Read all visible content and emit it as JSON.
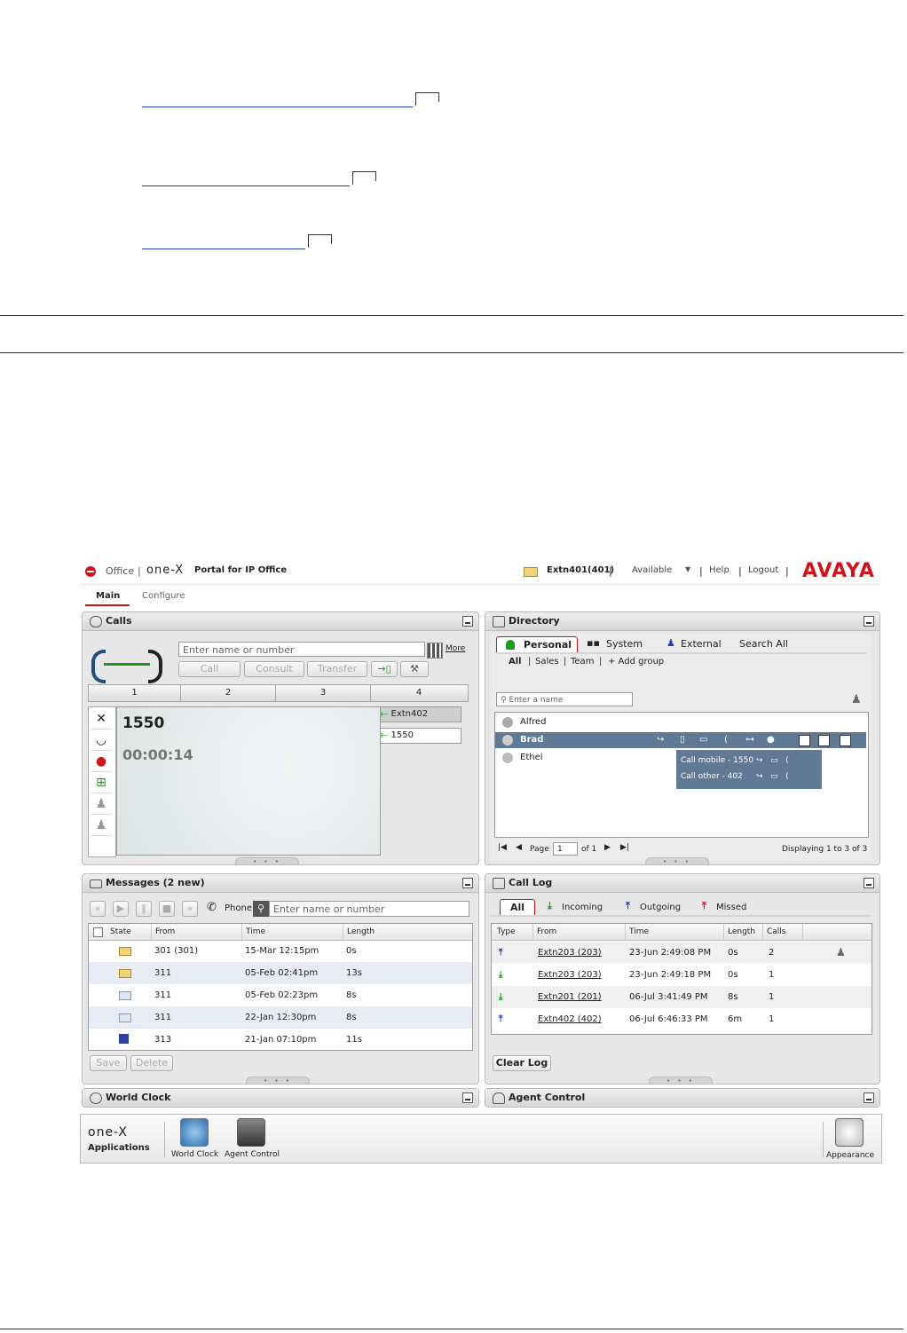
{
  "document": {
    "rule_label": ""
  },
  "app": {
    "title_office": "Office",
    "brand_product": "Portal for IP Office",
    "onex_logo": "one-X",
    "user": "Extn401(401)",
    "status": "Available",
    "help": "Help",
    "logout": "Logout",
    "vendor": "AVAYA",
    "tabs": [
      "Main",
      "Configure"
    ]
  },
  "calls": {
    "title": "Calls",
    "input_placeholder": "Enter name or number",
    "more": "More",
    "buttons": {
      "call": "Call",
      "consult": "Consult",
      "transfer": "Transfer"
    },
    "lines": [
      "1",
      "2",
      "3",
      "4"
    ],
    "active_number": "1550",
    "timer": "00:00:14",
    "right_lines": [
      "Extn402",
      "1550"
    ]
  },
  "directory": {
    "title": "Directory",
    "tabs": [
      "Personal",
      "System",
      "External",
      "Search All"
    ],
    "subtabs": [
      "All",
      "Sales",
      "Team",
      "+ Add group"
    ],
    "search_placeholder": "Enter a name",
    "entries": [
      "Alfred",
      "Brad",
      "Ethel"
    ],
    "popup": [
      "Call mobile - 1550",
      "Call other - 402"
    ],
    "page_label": "Page",
    "page_value": "1",
    "of_pages": "of 1",
    "displaying": "Displaying 1 to 3 of 3"
  },
  "messages": {
    "title": "Messages (2 new)",
    "phone_label": "Phone",
    "search_placeholder": "Enter name or number",
    "headers": [
      "State",
      "From",
      "Time",
      "Length"
    ],
    "rows": [
      {
        "from": "301 (301)",
        "time": "15-Mar 12:15pm",
        "length": "0s"
      },
      {
        "from": "311",
        "time": "05-Feb 02:41pm",
        "length": "13s"
      },
      {
        "from": "311",
        "time": "05-Feb 02:23pm",
        "length": "8s"
      },
      {
        "from": "311",
        "time": "22-Jan 12:30pm",
        "length": "8s"
      },
      {
        "from": "313",
        "time": "21-Jan 07:10pm",
        "length": "11s"
      }
    ],
    "save": "Save",
    "delete": "Delete"
  },
  "calllog": {
    "title": "Call Log",
    "tabs": [
      "All",
      "Incoming",
      "Outgoing",
      "Missed"
    ],
    "headers": [
      "Type",
      "From",
      "Time",
      "Length",
      "Calls"
    ],
    "rows": [
      {
        "dir": "out",
        "from": "Extn203 (203)",
        "time": "23-Jun 2:49:08 PM",
        "length": "0s",
        "calls": "2"
      },
      {
        "dir": "in",
        "from": "Extn203 (203)",
        "time": "23-Jun 2:49:18 PM",
        "length": "0s",
        "calls": "1"
      },
      {
        "dir": "in",
        "from": "Extn201 (201)",
        "time": "06-Jul 3:41:49 PM",
        "length": "8s",
        "calls": "1"
      },
      {
        "dir": "out",
        "from": "Extn402 (402)",
        "time": "06-Jul 6:46:33 PM",
        "length": "6m",
        "calls": "1"
      }
    ],
    "clear": "Clear Log"
  },
  "worldclock": {
    "title": "World Clock"
  },
  "agent": {
    "title": "Agent Control"
  },
  "apps": {
    "label": "Applications",
    "items": [
      "World Clock",
      "Agent Control"
    ],
    "appearance": "Appearance"
  },
  "colors": {
    "accent_red": "#d0141b",
    "link_blue": "#1f3fa8",
    "selected_row": "#607a96",
    "green": "#1a9a1a"
  }
}
